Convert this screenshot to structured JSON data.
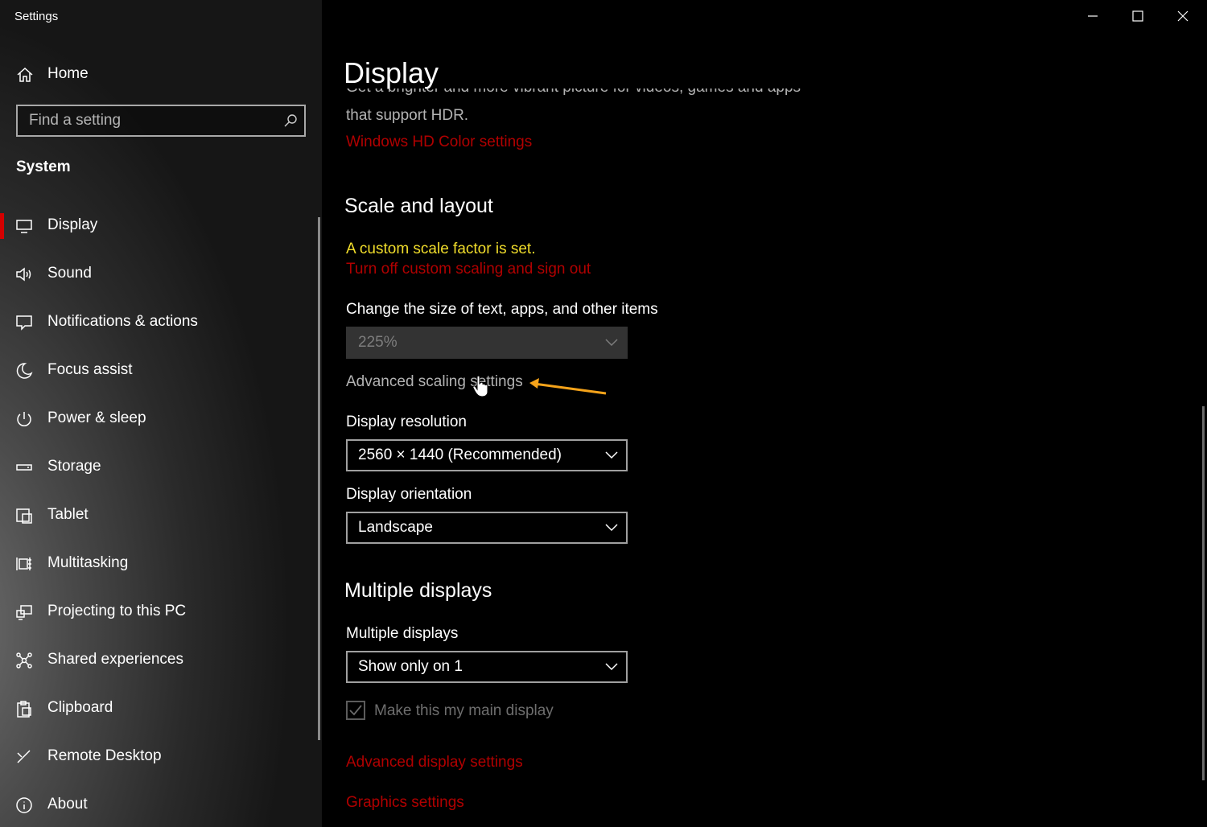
{
  "window": {
    "title": "Settings",
    "minimize_icon": "minimize-icon",
    "maximize_icon": "maximize-icon",
    "close_icon": "close-icon"
  },
  "sidebar": {
    "home_label": "Home",
    "search_placeholder": "Find a setting",
    "section_label": "System",
    "items": [
      {
        "label": "Display",
        "icon": "monitor-icon",
        "active": true
      },
      {
        "label": "Sound",
        "icon": "speaker-icon"
      },
      {
        "label": "Notifications & actions",
        "icon": "message-icon"
      },
      {
        "label": "Focus assist",
        "icon": "moon-icon"
      },
      {
        "label": "Power & sleep",
        "icon": "power-icon"
      },
      {
        "label": "Storage",
        "icon": "storage-drive-icon"
      },
      {
        "label": "Tablet",
        "icon": "tablet-icon"
      },
      {
        "label": "Multitasking",
        "icon": "multitasking-icon"
      },
      {
        "label": "Projecting to this PC",
        "icon": "projecting-icon"
      },
      {
        "label": "Shared experiences",
        "icon": "shared-experiences-icon"
      },
      {
        "label": "Clipboard",
        "icon": "clipboard-icon"
      },
      {
        "label": "Remote Desktop",
        "icon": "remote-desktop-icon"
      },
      {
        "label": "About",
        "icon": "info-icon"
      }
    ]
  },
  "main": {
    "title": "Display",
    "hdr_fragment_1": "Get a brighter and more vibrant picture for videos, games and apps",
    "hdr_fragment_2": "that support HDR.",
    "hdr_link": "Windows HD Color settings",
    "scale_heading": "Scale and layout",
    "custom_scale_warning": "A custom scale factor is set.",
    "turn_off_link": "Turn off custom scaling and sign out",
    "size_label": "Change the size of text, apps, and other items",
    "size_value": "225%",
    "advanced_scaling": "Advanced scaling settings",
    "resolution_label": "Display resolution",
    "resolution_value": "2560 × 1440 (Recommended)",
    "orientation_label": "Display orientation",
    "orientation_value": "Landscape",
    "multiple_heading": "Multiple displays",
    "multiple_label": "Multiple displays",
    "multiple_value": "Show only on 1",
    "main_display_checkbox": "Make this my main display",
    "main_display_checked": true,
    "advanced_display_link": "Advanced display settings",
    "graphics_link": "Graphics settings"
  },
  "colors": {
    "accent_red": "#d40000",
    "link_red": "#b00000",
    "warning_yellow": "#f1dd2b",
    "annotation_arrow": "#f5a31a"
  }
}
